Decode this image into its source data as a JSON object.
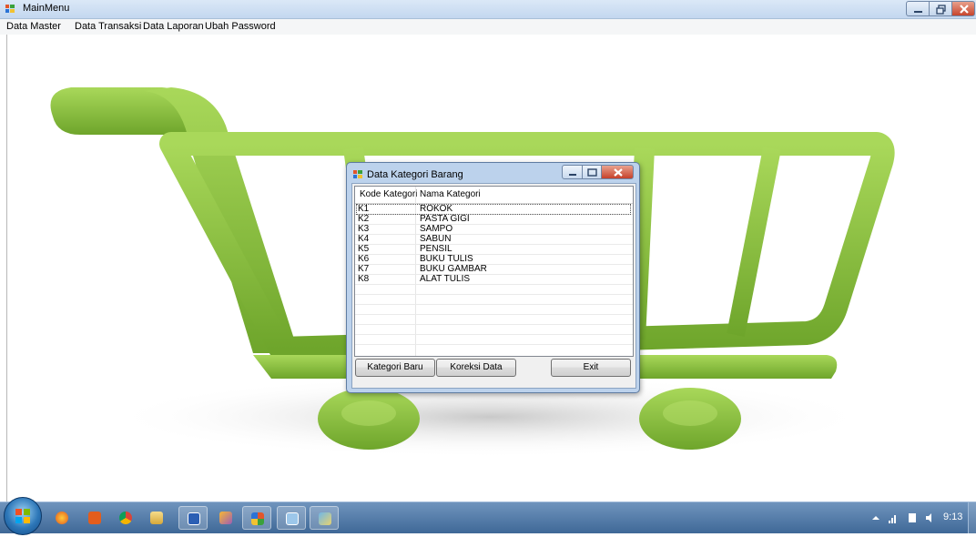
{
  "main_window": {
    "title": "MainMenu"
  },
  "menu": {
    "items": [
      "Data Master",
      "Data Transaksi",
      "Data Laporan",
      "Ubah Password"
    ]
  },
  "dialog": {
    "title": "Data Kategori Barang",
    "columns": [
      "Kode Kategori",
      "Nama Kategori"
    ],
    "rows": [
      {
        "kode": "K1",
        "nama": "ROKOK"
      },
      {
        "kode": "K2",
        "nama": "PASTA GIGI"
      },
      {
        "kode": "K3",
        "nama": "SAMPO"
      },
      {
        "kode": "K4",
        "nama": "SABUN"
      },
      {
        "kode": "K5",
        "nama": "PENSIL"
      },
      {
        "kode": "K6",
        "nama": "BUKU TULIS"
      },
      {
        "kode": "K7",
        "nama": "BUKU GAMBAR"
      },
      {
        "kode": "K8",
        "nama": "ALAT TULIS"
      }
    ],
    "buttons": {
      "new": "Kategori Baru",
      "edit": "Koreksi Data",
      "exit": "Exit"
    }
  },
  "taskbar": {
    "apps": [
      "start-orb",
      "firefox",
      "office",
      "chrome",
      "file-explorer",
      "word",
      "visual-studio",
      "mainmenu-app",
      "window-app",
      "paint"
    ],
    "clock": "9:13"
  },
  "colors": {
    "cart_green": "#8cc63f",
    "cart_dark_green": "#5a8f1c",
    "titlebar_blue": "#c3d7ef",
    "close_red": "#c7452d"
  }
}
